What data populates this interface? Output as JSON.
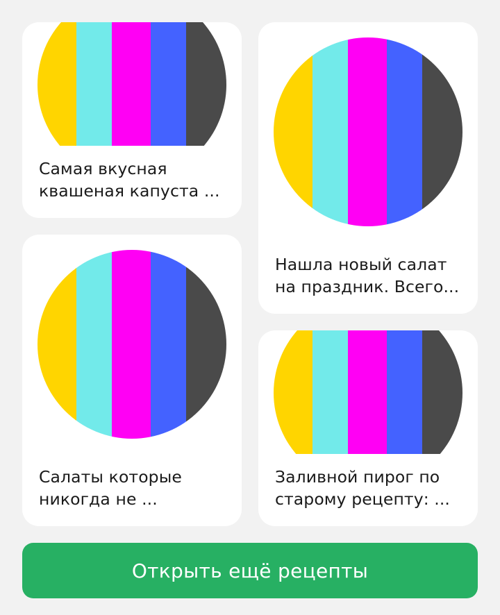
{
  "colors": {
    "page_background": "#f2f2f2",
    "card_background": "#ffffff",
    "button_background": "#27b063",
    "button_text": "#ffffff",
    "title_text": "#1a1a1a",
    "placeholder_stripes": [
      "#ffd500",
      "#72eaea",
      "#ff00f4",
      "#4462ff",
      "#4a4a4a"
    ]
  },
  "cards": [
    {
      "image": "recipe-placeholder-image",
      "title": "Самая вкусная\nквашеная капуста ..."
    },
    {
      "image": "recipe-placeholder-image",
      "title": "Нашла новый салат\nна праздник. Всего..."
    },
    {
      "image": "recipe-placeholder-image",
      "title": "Салаты которые\nникогда не ..."
    },
    {
      "image": "recipe-placeholder-image",
      "title": "Заливной пирог по\nстарому рецепту: ..."
    }
  ],
  "more_button": {
    "label": "Открыть ещё рецепты"
  }
}
